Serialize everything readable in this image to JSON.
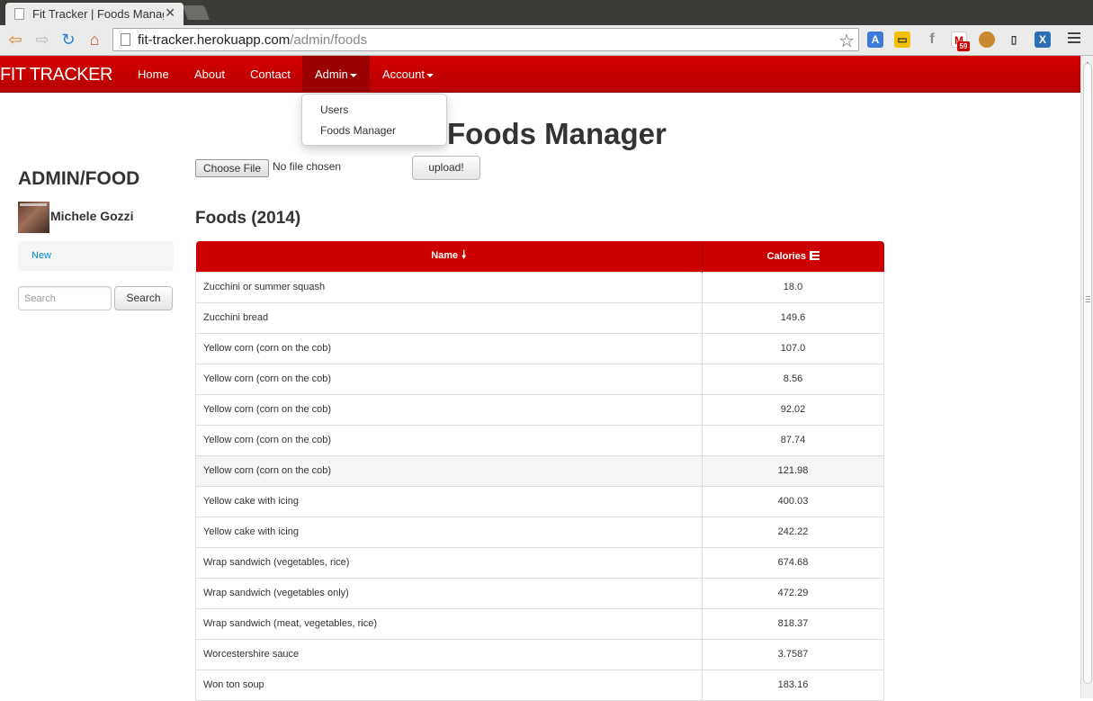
{
  "browser": {
    "tab_title": "Fit Tracker | Foods Manag",
    "url_host": "fit-tracker.herokuapp.com",
    "url_path": "/admin/foods",
    "gmail_badge": "59"
  },
  "navbar": {
    "brand": "FIT TRACKER",
    "items": [
      "Home",
      "About",
      "Contact",
      "Admin",
      "Account"
    ]
  },
  "dropdown": {
    "items": [
      "Users",
      "Foods Manager"
    ]
  },
  "page_title": "Foods Manager",
  "sidebar": {
    "title": "ADMIN/FOOD",
    "user_name": "Michele Gozzi",
    "nav_link": "New",
    "search_placeholder": "Search",
    "search_button": "Search"
  },
  "upload": {
    "choose_file": "Choose File",
    "no_file": "No file chosen",
    "upload_button": "upload!"
  },
  "section_title": "Foods (2014)",
  "table": {
    "headers": [
      "Name",
      "Calories"
    ],
    "rows": [
      {
        "name": "Zucchini or summer squash",
        "calories": "18.0"
      },
      {
        "name": "Zucchini bread",
        "calories": "149.6"
      },
      {
        "name": "Yellow corn (corn on the cob)",
        "calories": "107.0"
      },
      {
        "name": "Yellow corn (corn on the cob)",
        "calories": "8.56"
      },
      {
        "name": "Yellow corn (corn on the cob)",
        "calories": "92.02"
      },
      {
        "name": "Yellow corn (corn on the cob)",
        "calories": "87.74"
      },
      {
        "name": "Yellow corn (corn on the cob)",
        "calories": "121.98"
      },
      {
        "name": "Yellow cake with icing",
        "calories": "400.03"
      },
      {
        "name": "Yellow cake with icing",
        "calories": "242.22"
      },
      {
        "name": "Wrap sandwich (vegetables, rice)",
        "calories": "674.68"
      },
      {
        "name": "Wrap sandwich (vegetables only)",
        "calories": "472.29"
      },
      {
        "name": "Wrap sandwich (meat, vegetables, rice)",
        "calories": "818.37"
      },
      {
        "name": "Worcestershire sauce",
        "calories": "3.7587"
      },
      {
        "name": "Won ton soup",
        "calories": "183.16"
      }
    ]
  },
  "colors": {
    "brand_red": "#cc0000",
    "link_blue": "#0088cc"
  }
}
